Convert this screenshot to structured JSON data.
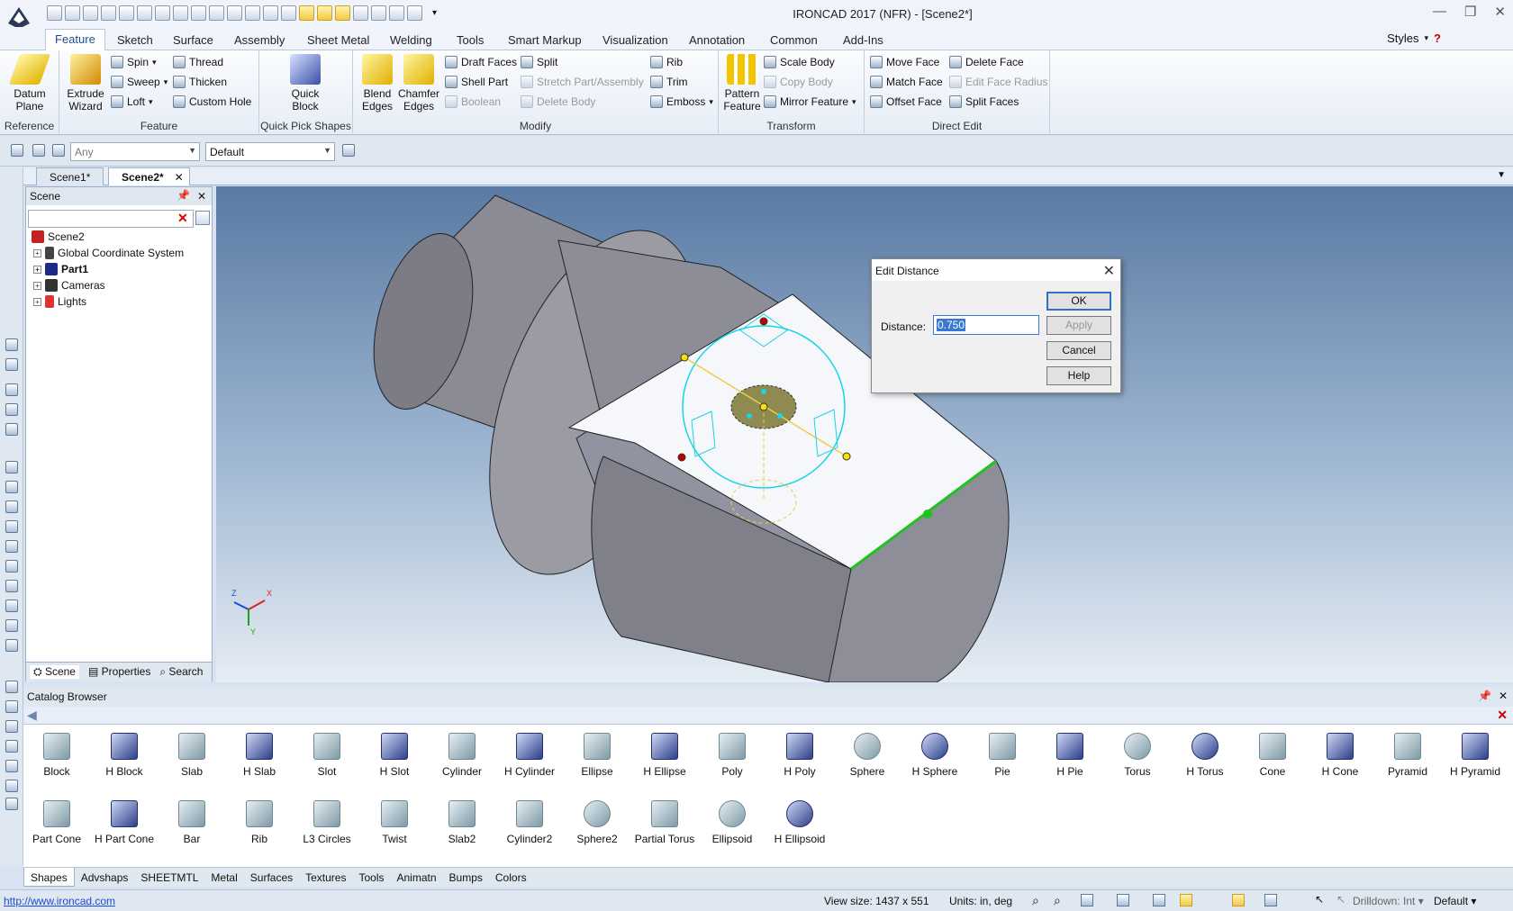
{
  "app": {
    "title": "IRONCAD 2017 (NFR) - [Scene2*]"
  },
  "colors": {
    "accent": "#1f4e8c",
    "selection": "#3a78d0",
    "part_gray": "#8d8e97",
    "edge_green": "#1fc21f"
  },
  "ribbon_tabs": [
    "Feature",
    "Sketch",
    "Surface",
    "Assembly",
    "Sheet Metal",
    "Welding",
    "Tools",
    "Smart Markup",
    "Visualization",
    "Annotation",
    "Common",
    "Add-Ins"
  ],
  "styles_label": "Styles",
  "ribbon": {
    "reference": {
      "label": "Reference",
      "datum": "Datum\nPlane"
    },
    "feature": {
      "label": "Feature",
      "extrude": "Extrude\nWizard",
      "spin": "Spin",
      "sweep": "Sweep",
      "loft": "Loft",
      "thread": "Thread",
      "thicken": "Thicken",
      "custom_hole": "Custom Hole"
    },
    "quick_pick": {
      "label": "Quick Pick Shapes",
      "quick_block": "Quick\nBlock"
    },
    "modify": {
      "label": "Modify",
      "blend": "Blend\nEdges",
      "chamfer": "Chamfer\nEdges",
      "draft": "Draft Faces",
      "shell": "Shell Part",
      "boolean": "Boolean",
      "split": "Split",
      "stretch": "Stretch Part/Assembly",
      "delete_body": "Delete Body",
      "rib": "Rib",
      "trim": "Trim",
      "emboss": "Emboss"
    },
    "transform": {
      "label": "Transform",
      "pattern": "Pattern\nFeature",
      "scale": "Scale Body",
      "copy": "Copy Body",
      "mirror": "Mirror Feature"
    },
    "direct_edit": {
      "label": "Direct Edit",
      "move_face": "Move Face",
      "match_face": "Match Face",
      "offset_face": "Offset Face",
      "delete_face": "Delete Face",
      "edit_radius": "Edit Face Radius",
      "split_faces": "Split Faces"
    }
  },
  "selection_bar": {
    "filter": "Any",
    "style": "Default"
  },
  "doc_tabs": [
    "Scene1*",
    "Scene2*"
  ],
  "scene_panel": {
    "title": "Scene",
    "tree": [
      "Scene2",
      "Global Coordinate System",
      "Part1",
      "Cameras",
      "Lights"
    ],
    "tabs": [
      "Scene",
      "Properties",
      "Search"
    ]
  },
  "triad": {
    "z": "Z",
    "x": "X",
    "y": "Y"
  },
  "dialog": {
    "title": "Edit Distance",
    "label": "Distance:",
    "value": "0.750",
    "ok": "OK",
    "apply": "Apply",
    "cancel": "Cancel",
    "help": "Help"
  },
  "catalog": {
    "title": "Catalog Browser",
    "row1": [
      "Block",
      "H Block",
      "Slab",
      "H Slab",
      "Slot",
      "H Slot",
      "Cylinder",
      "H Cylinder",
      "Ellipse",
      "H Ellipse",
      "Poly",
      "H Poly",
      "Sphere",
      "H Sphere",
      "Pie",
      "H Pie",
      "Torus",
      "H Torus",
      "Cone",
      "H Cone",
      "Pyramid",
      "H Pyramid"
    ],
    "row2": [
      "Part Cone",
      "H Part Cone",
      "Bar",
      "Rib",
      "L3 Circles",
      "Twist",
      "Slab2",
      "Cylinder2",
      "Sphere2",
      "Partial Torus",
      "Ellipsoid",
      "H Ellipsoid"
    ],
    "tabs": [
      "Shapes",
      "Advshaps",
      "SHEETMTL",
      "Metal",
      "Surfaces",
      "Textures",
      "Tools",
      "Animatn",
      "Bumps",
      "Colors"
    ]
  },
  "status": {
    "url": "http://www.ironcad.com",
    "view_size": "View size: 1437 x  551",
    "units": "Units: in, deg",
    "drilldown": "Drilldown: Int",
    "style": "Default"
  }
}
